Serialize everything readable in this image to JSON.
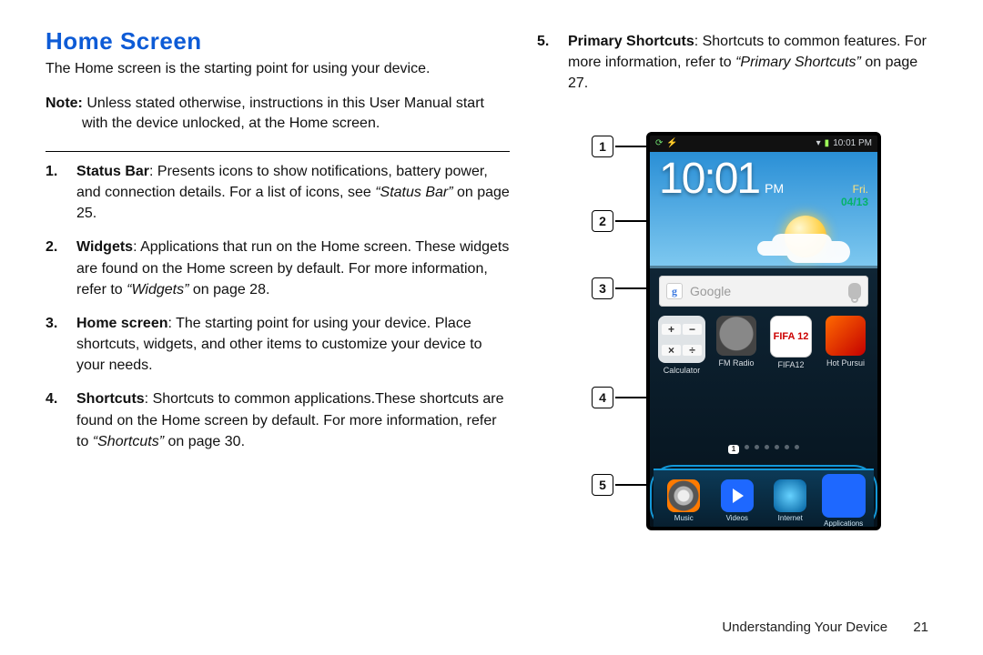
{
  "header": {
    "title": "Home Screen"
  },
  "intro": "The Home screen is the starting point for using your device.",
  "note_label": "Note:",
  "note_body": " Unless stated otherwise, instructions in this User Manual start with the device unlocked, at the Home screen.",
  "items": [
    {
      "n": "1.",
      "title": "Status Bar",
      "body_a": ": Presents icons to show notifications, battery power, and connection details. For a list of icons, see ",
      "ref": "“Status Bar”",
      "body_b": " on page 25."
    },
    {
      "n": "2.",
      "title": "Widgets",
      "body_a": ": Applications that run on the Home screen. These widgets are found on the Home screen by default. For more information, refer to ",
      "ref": "“Widgets”",
      "body_b": "  on page 28."
    },
    {
      "n": "3.",
      "title": "Home screen",
      "body_a": ": The starting point for using your device. Place shortcuts, widgets, and other items to customize your device to your needs.",
      "ref": "",
      "body_b": ""
    },
    {
      "n": "4.",
      "title": "Shortcuts",
      "body_a": ": Shortcuts to common applications.These shortcuts are found on the Home screen by default. For more information, refer to ",
      "ref": "“Shortcuts”",
      "body_b": "  on page 30."
    },
    {
      "n": "5.",
      "title": "Primary Shortcuts",
      "body_a": ": Shortcuts to common features. For more information, refer to ",
      "ref": "“Primary Shortcuts”",
      "body_b": "  on page 27."
    }
  ],
  "callout_labels": [
    "1",
    "2",
    "3",
    "4",
    "5"
  ],
  "statusbar": {
    "time": "10:01 PM"
  },
  "clock": {
    "time": "10:01",
    "ampm": "PM",
    "day": "Fri.",
    "date": "04/13"
  },
  "search_placeholder": "Google",
  "apps": [
    {
      "label": "Calculator"
    },
    {
      "label": "FM Radio"
    },
    {
      "label": "FIFA12"
    },
    {
      "label": "Hot Pursui"
    }
  ],
  "pager_current": "1",
  "dock": [
    {
      "label": "Music"
    },
    {
      "label": "Videos"
    },
    {
      "label": "Internet"
    },
    {
      "label": "Applications"
    }
  ],
  "footer": {
    "section": "Understanding Your Device",
    "page": "21"
  },
  "fifa_text": "FIFA 12",
  "calc_keys": [
    "+",
    "−",
    "×",
    "÷"
  ]
}
